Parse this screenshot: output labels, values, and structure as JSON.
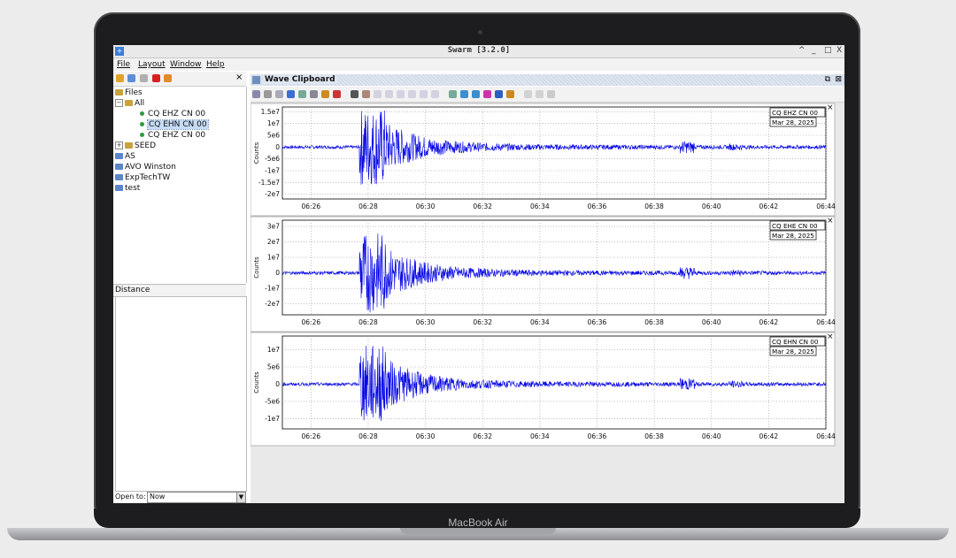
{
  "device": {
    "label": "MacBook Air"
  },
  "app": {
    "title": "Swarm [3.2.0]",
    "window_controls": [
      "^",
      "_",
      "□",
      "X"
    ]
  },
  "menu": [
    "File",
    "Layout",
    "Window",
    "Help"
  ],
  "left_panel": {
    "close": "×",
    "tree": {
      "root": "Files",
      "all": "All",
      "channels": [
        "CQ EHZ CN 00",
        "CQ EHN CN 00",
        "CQ EHZ CN 00"
      ],
      "selected_index": 1,
      "groups": [
        "SEED",
        "AS",
        "AVO Winston",
        "ExpTechTW",
        "test"
      ]
    },
    "distance_label": "Distance",
    "open_to_label": "Open to:",
    "open_to_value": "Now"
  },
  "clipboard": {
    "title": "Wave Clipboard"
  },
  "colors": {
    "wave": "#0000e6",
    "selection": "#c6dcf5"
  },
  "chart_data": [
    {
      "type": "line",
      "title": "",
      "legend": [
        "CQ EHZ CN 00",
        "Mar 28, 2025"
      ],
      "ylabel": "Counts",
      "xlabel": "",
      "x_ticks": [
        "06:26",
        "06:28",
        "06:30",
        "06:32",
        "06:34",
        "06:36",
        "06:38",
        "06:40",
        "06:42",
        "06:44"
      ],
      "y_ticks": [
        "1.5e7",
        "1e7",
        "5e6",
        "0",
        "-5e6",
        "-1e7",
        "-1.5e7",
        "-2e7"
      ],
      "ylim": [
        -22000000.0,
        17000000.0
      ],
      "x_range": [
        "06:25",
        "06:44"
      ],
      "event_onset": "06:27:45"
    },
    {
      "type": "line",
      "title": "",
      "legend": [
        "CQ EHE CN 00",
        "Mar 28, 2025"
      ],
      "ylabel": "Counts",
      "xlabel": "",
      "x_ticks": [
        "06:26",
        "06:28",
        "06:30",
        "06:32",
        "06:34",
        "06:36",
        "06:38",
        "06:40",
        "06:42",
        "06:44"
      ],
      "y_ticks": [
        "3e7",
        "2e7",
        "1e7",
        "0",
        "-1e7",
        "-2e7"
      ],
      "ylim": [
        -27000000.0,
        34000000.0
      ],
      "x_range": [
        "06:25",
        "06:44"
      ],
      "event_onset": "06:27:45"
    },
    {
      "type": "line",
      "title": "",
      "legend": [
        "CQ EHN CN 00",
        "Mar 28, 2025"
      ],
      "ylabel": "Counts",
      "xlabel": "",
      "x_ticks": [
        "06:26",
        "06:28",
        "06:30",
        "06:32",
        "06:34",
        "06:36",
        "06:38",
        "06:40",
        "06:42",
        "06:44"
      ],
      "y_ticks": [
        "1e7",
        "5e6",
        "0",
        "-5e6",
        "-1e7"
      ],
      "ylim": [
        -13000000.0,
        14000000.0
      ],
      "x_range": [
        "06:25",
        "06:44"
      ],
      "event_onset": "06:27:45"
    }
  ]
}
